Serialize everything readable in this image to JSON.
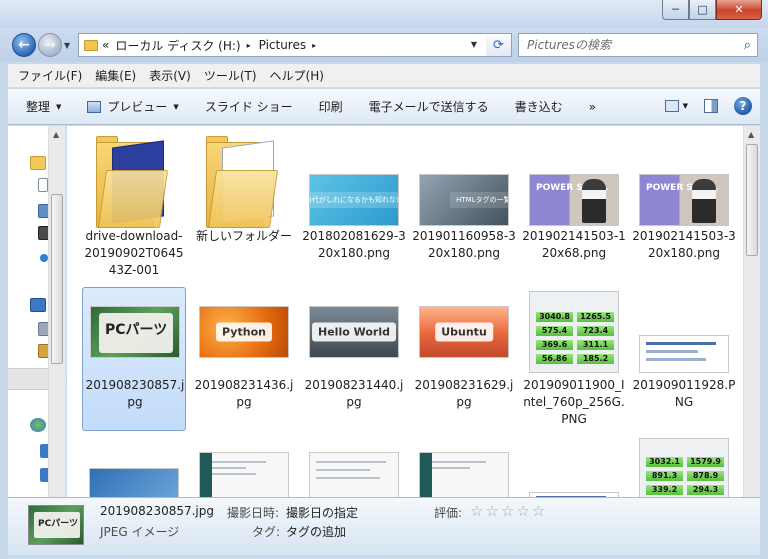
{
  "window": {
    "min": "─",
    "max": "□",
    "close": "✕"
  },
  "address": {
    "root_sep": "«",
    "crumbs": [
      "ローカル ディスク (H:)",
      "Pictures"
    ],
    "sep": "▸"
  },
  "search": {
    "placeholder": "Picturesの検索"
  },
  "menu": [
    "ファイル(F)",
    "編集(E)",
    "表示(V)",
    "ツール(T)",
    "ヘルプ(H)"
  ],
  "commands": {
    "organize": "整理",
    "preview": "プレビュー",
    "slideshow": "スライド ショー",
    "print": "印刷",
    "email": "電子メールで送信する",
    "burn": "書き込む",
    "more": "»"
  },
  "items": [
    {
      "name": "drive-download-20190902T064543Z-001",
      "kind": "folder"
    },
    {
      "name": "新しいフォルダー",
      "kind": "folder"
    },
    {
      "name": "201802081629-320x180.png",
      "kind": "image",
      "thumb_text": "タバコ代がしれになるかも知れない方法"
    },
    {
      "name": "201901160958-320x180.png",
      "kind": "image",
      "thumb_text": "HTMLタグの一覧"
    },
    {
      "name": "201902141503-120x68.png",
      "kind": "image",
      "thumb_text": "POWER SHELL"
    },
    {
      "name": "201902141503-320x180.png",
      "kind": "image",
      "thumb_text": "POWER SHELL"
    },
    {
      "name": "201908230857.jpg",
      "kind": "image",
      "thumb_text": "PCパーツ",
      "selected": true
    },
    {
      "name": "201908231436.jpg",
      "kind": "image",
      "thumb_text": "Python"
    },
    {
      "name": "201908231440.jpg",
      "kind": "image",
      "thumb_text": "Hello World"
    },
    {
      "name": "201908231629.jpg",
      "kind": "image",
      "thumb_text": "Ubuntu"
    },
    {
      "name": "201909011900_Intel_760p_256G.PNG",
      "kind": "image",
      "bench": [
        "3040.8",
        "1265.5",
        "575.4",
        "723.4",
        "369.6",
        "311.1",
        "56.86",
        "185.2"
      ]
    },
    {
      "name": "201909011928.PNG",
      "kind": "image"
    }
  ],
  "partial_bench": [
    "3032.1",
    "1579.9",
    "891.3",
    "878.9",
    "339.2",
    "294.3"
  ],
  "details": {
    "file_name": "201908230857.jpg",
    "file_type": "JPEG イメージ",
    "date_label": "撮影日時:",
    "date_value": "撮影日の指定",
    "tag_label": "タグ:",
    "tag_value": "タグの追加",
    "rating_label": "評価:",
    "rating_stars": "☆☆☆☆☆",
    "thumb_text": "PCパーツ"
  }
}
